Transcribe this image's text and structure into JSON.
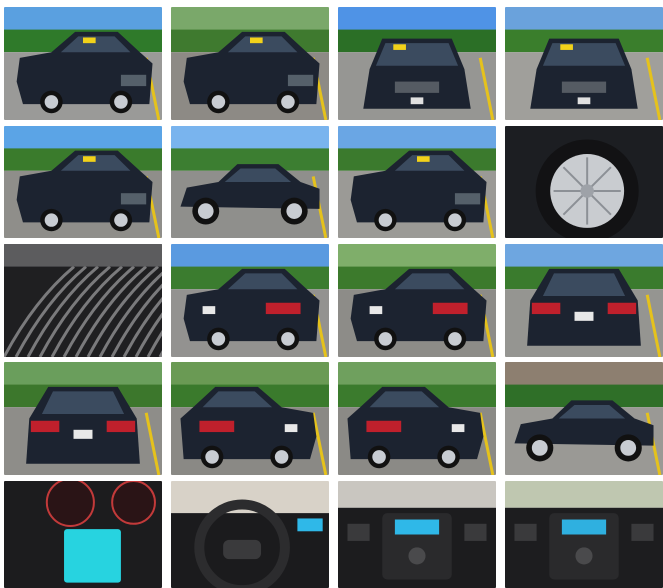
{
  "gallery": {
    "columns": 4,
    "rows": 5,
    "photos": [
      {
        "subject": "front-left-view",
        "palette": {
          "sky": "#5aa0e0",
          "ground": "#9a9a98",
          "accent": "#2f7a2a"
        }
      },
      {
        "subject": "front-left-view",
        "palette": {
          "sky": "#7aa86a",
          "ground": "#8d8a85",
          "accent": "#3f7a2f"
        }
      },
      {
        "subject": "front-view",
        "palette": {
          "sky": "#4f93e6",
          "ground": "#969693",
          "accent": "#2b6f26"
        }
      },
      {
        "subject": "front-view",
        "palette": {
          "sky": "#6aa2dc",
          "ground": "#a09f9b",
          "accent": "#3a7e2c"
        }
      },
      {
        "subject": "left-front-view",
        "palette": {
          "sky": "#5ba4e6",
          "ground": "#8f8e8a",
          "accent": "#3a7b2c"
        }
      },
      {
        "subject": "left-side-view",
        "palette": {
          "sky": "#79b4ee",
          "ground": "#8f8f8c",
          "accent": "#3c7e31"
        }
      },
      {
        "subject": "left-front-view",
        "palette": {
          "sky": "#6aa6e4",
          "ground": "#9b9a96",
          "accent": "#3b7a2d"
        }
      },
      {
        "subject": "wheel-closeup",
        "palette": {
          "sky": "#8a8a88",
          "ground": "#2a2a2c",
          "accent": "#c9ccd0"
        }
      },
      {
        "subject": "tire-closeup",
        "palette": {
          "sky": "#5c5c5e",
          "ground": "#1f1f21",
          "accent": "#7a7a7c"
        }
      },
      {
        "subject": "rear-left-view",
        "palette": {
          "sky": "#5a9ae0",
          "ground": "#939290",
          "accent": "#3b7c2f"
        }
      },
      {
        "subject": "rear-left-view",
        "palette": {
          "sky": "#7fae6a",
          "ground": "#8d8c88",
          "accent": "#3c7a2c"
        }
      },
      {
        "subject": "rear-view",
        "palette": {
          "sky": "#6ea6e0",
          "ground": "#959591",
          "accent": "#3a7b2d"
        }
      },
      {
        "subject": "rear-view",
        "palette": {
          "sky": "#6a9e5c",
          "ground": "#8e8d89",
          "accent": "#3c772c"
        }
      },
      {
        "subject": "rear-right-view",
        "palette": {
          "sky": "#6a9a54",
          "ground": "#8a8985",
          "accent": "#3a7a2c"
        }
      },
      {
        "subject": "rear-right-view",
        "palette": {
          "sky": "#6fa05e",
          "ground": "#8b8a86",
          "accent": "#3b7b2d"
        }
      },
      {
        "subject": "left-side-view",
        "palette": {
          "sky": "#8d7f70",
          "ground": "#9a9995",
          "accent": "#2f6f28"
        }
      },
      {
        "subject": "instrument-cluster",
        "palette": {
          "sky": "#1c1c1e",
          "ground": "#0d0d0f",
          "accent": "#27d3e0"
        }
      },
      {
        "subject": "steering-wheel",
        "palette": {
          "sky": "#d8d2c8",
          "ground": "#1b1b1d",
          "accent": "#2c2c2e"
        }
      },
      {
        "subject": "center-console",
        "palette": {
          "sky": "#c9c6c0",
          "ground": "#1c1c1e",
          "accent": "#2fb8e8"
        }
      },
      {
        "subject": "center-console",
        "palette": {
          "sky": "#bfc7b0",
          "ground": "#1d1d1f",
          "accent": "#2fb0e0"
        }
      }
    ]
  }
}
